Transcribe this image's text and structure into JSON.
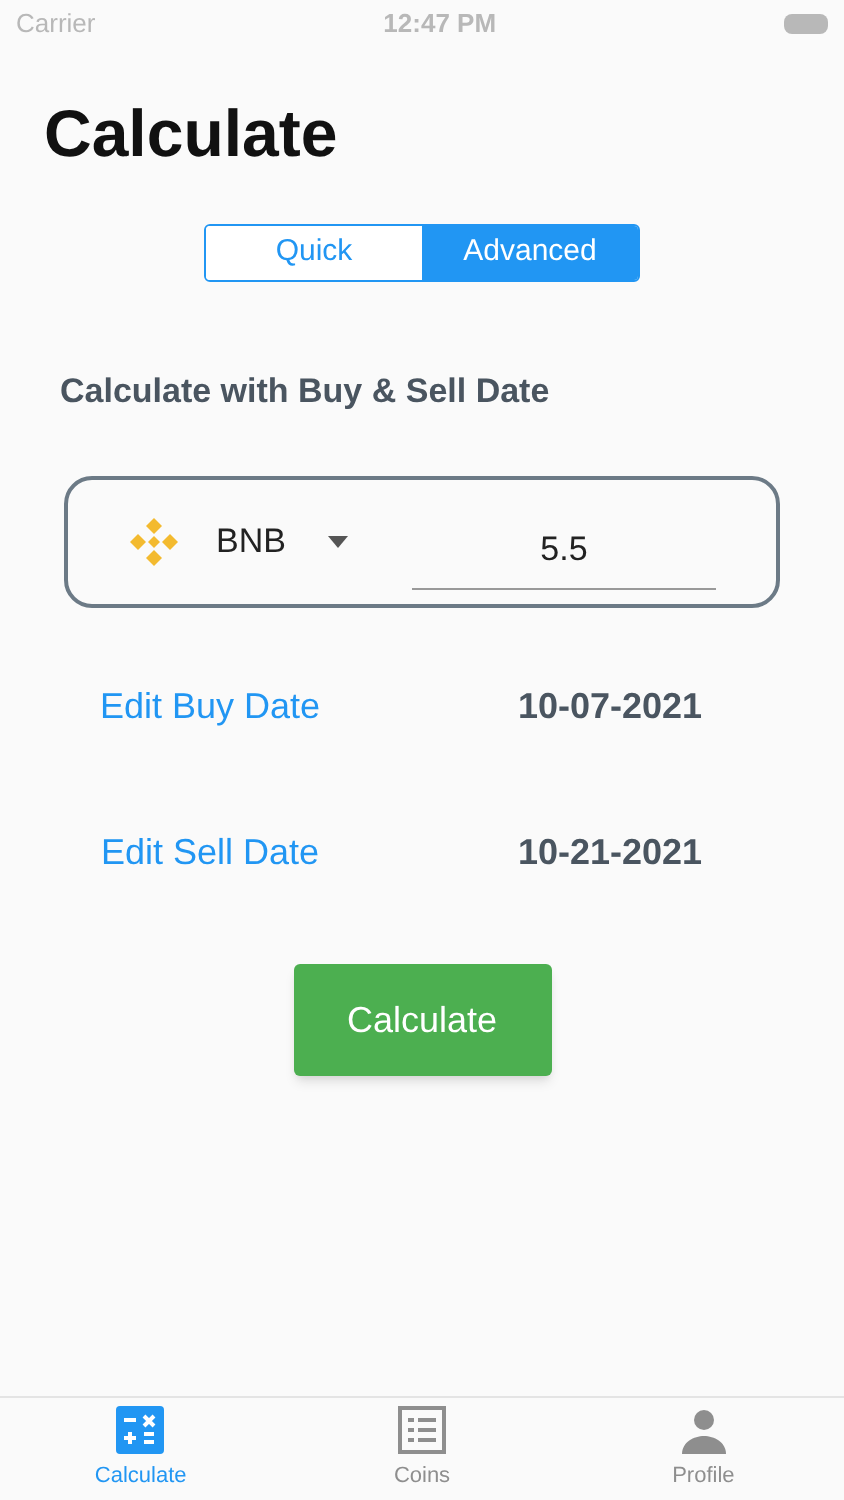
{
  "status_bar": {
    "carrier": "Carrier",
    "time": "12:47 PM"
  },
  "title": "Calculate",
  "segments": [
    {
      "label": "Quick",
      "selected": false
    },
    {
      "label": "Advanced",
      "selected": true
    }
  ],
  "subtitle": "Calculate with Buy & Sell Date",
  "coin": {
    "symbol": "BNB",
    "amount": "5.5"
  },
  "dates": [
    {
      "action": "Edit Buy Date",
      "value": "10-07-2021"
    },
    {
      "action": "Edit Sell Date",
      "value": "10-21-2021"
    }
  ],
  "calculate_button": "Calculate",
  "tabs": [
    {
      "label": "Calculate",
      "kind": "calculator",
      "selected": true
    },
    {
      "label": "Coins",
      "kind": "list",
      "selected": false
    },
    {
      "label": "Profile",
      "kind": "person",
      "selected": false
    }
  ]
}
